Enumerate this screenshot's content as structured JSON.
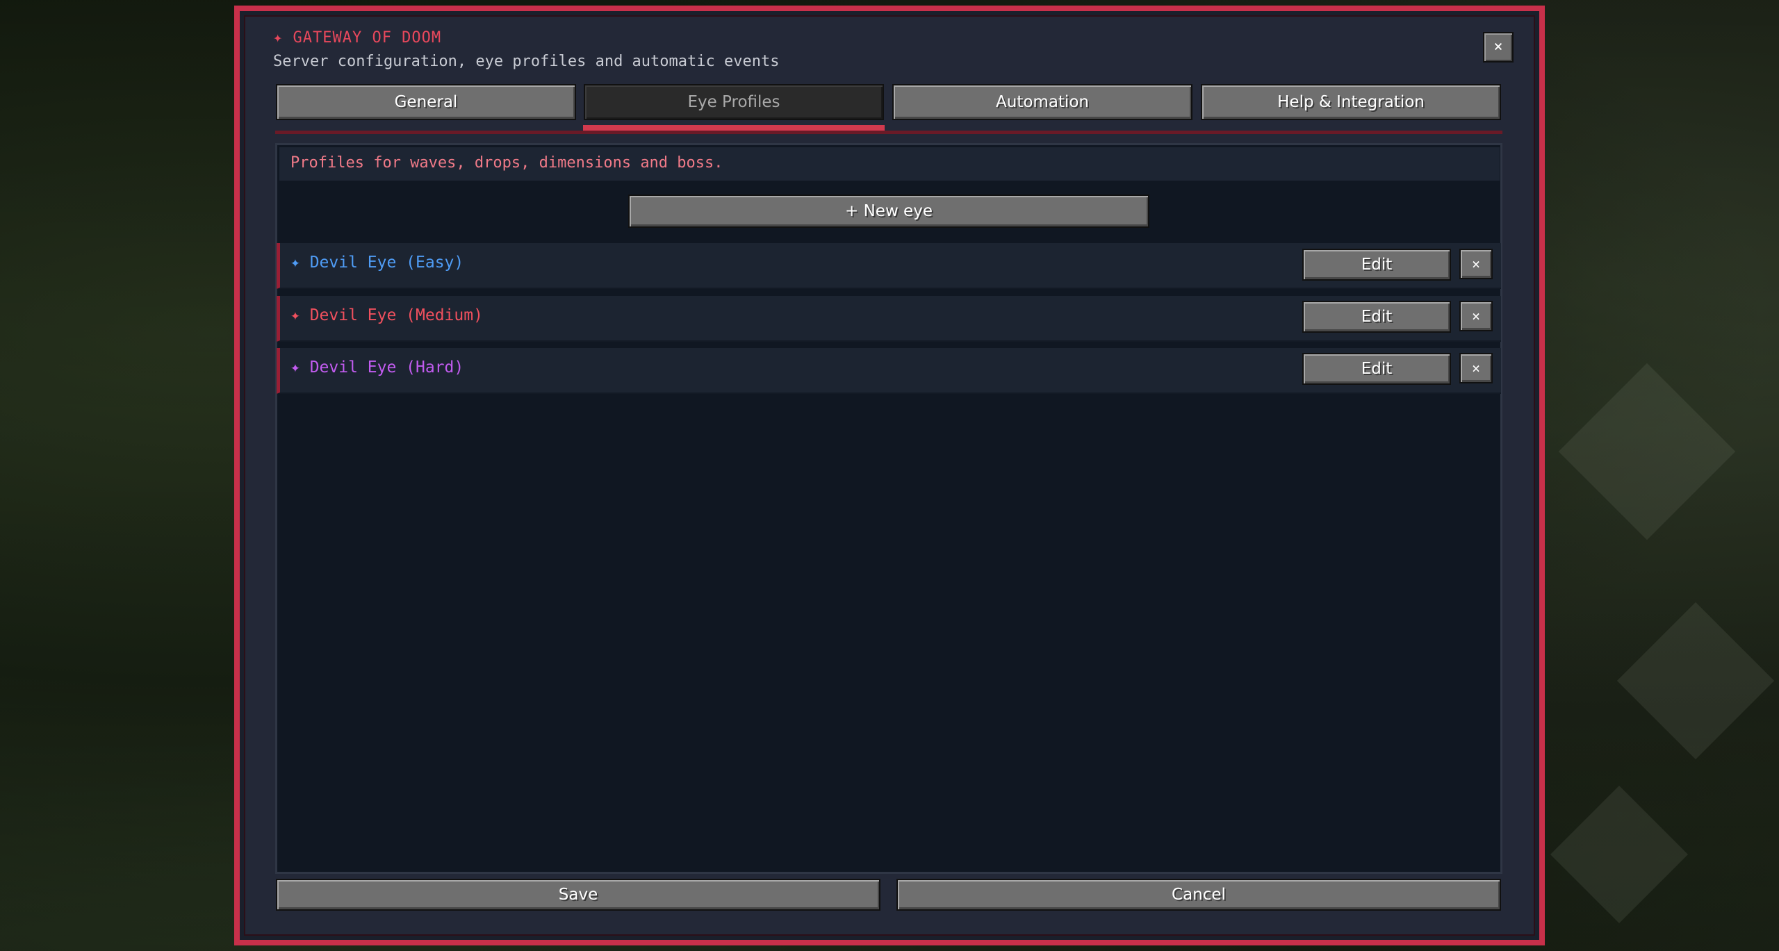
{
  "header": {
    "title": "✦ GATEWAY OF DOOM",
    "subtitle": "Server configuration, eye profiles and automatic events",
    "close_label": "×"
  },
  "tabs": [
    {
      "label": "General",
      "active": false
    },
    {
      "label": "Eye Profiles",
      "active": true
    },
    {
      "label": "Automation",
      "active": false
    },
    {
      "label": "Help & Integration",
      "active": false
    }
  ],
  "profiles_panel": {
    "info_text": "Profiles for waves, drops, dimensions and boss.",
    "new_button_label": "+ New eye",
    "items": [
      {
        "name": "✦ Devil Eye (Easy)",
        "color": "#4f9cf5",
        "edit_label": "Edit",
        "remove_label": "×"
      },
      {
        "name": "✦ Devil Eye (Medium)",
        "color": "#f0505e",
        "edit_label": "Edit",
        "remove_label": "×"
      },
      {
        "name": "✦ Devil Eye (Hard)",
        "color": "#c25cf0",
        "edit_label": "Edit",
        "remove_label": "×"
      }
    ]
  },
  "footer": {
    "save_label": "Save",
    "cancel_label": "Cancel"
  },
  "colors": {
    "frame_accent": "#c8304a",
    "title_red": "#e8485c",
    "info_pink": "#f07a88"
  }
}
